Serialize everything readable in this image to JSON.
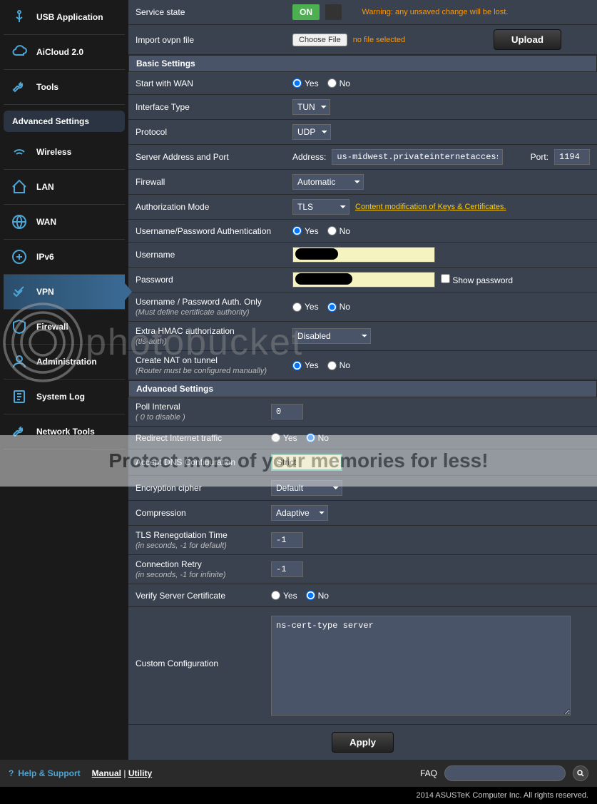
{
  "sidebar": {
    "topItems": [
      {
        "label": "USB Application",
        "icon": "usb"
      },
      {
        "label": "AiCloud 2.0",
        "icon": "cloud"
      },
      {
        "label": "Tools",
        "icon": "wrench"
      }
    ],
    "advancedHeader": "Advanced Settings",
    "advancedItems": [
      {
        "label": "Wireless",
        "icon": "wifi"
      },
      {
        "label": "LAN",
        "icon": "home"
      },
      {
        "label": "WAN",
        "icon": "globe"
      },
      {
        "label": "IPv6",
        "icon": "ipv6"
      },
      {
        "label": "VPN",
        "icon": "vpn",
        "active": true
      },
      {
        "label": "Firewall",
        "icon": "shield"
      },
      {
        "label": "Administration",
        "icon": "user"
      },
      {
        "label": "System Log",
        "icon": "log"
      },
      {
        "label": "Network Tools",
        "icon": "tools"
      }
    ]
  },
  "form": {
    "serviceStateLabel": "Service state",
    "serviceStateValue": "ON",
    "serviceStateWarning": "Warning: any unsaved change will be lost.",
    "importLabel": "Import ovpn file",
    "chooseFileLabel": "Choose File",
    "noFileSelected": "no file selected",
    "uploadLabel": "Upload",
    "basicSettingsHeader": "Basic Settings",
    "startWithWanLabel": "Start with WAN",
    "yes": "Yes",
    "no": "No",
    "interfaceTypeLabel": "Interface Type",
    "interfaceTypeValue": "TUN",
    "protocolLabel": "Protocol",
    "protocolValue": "UDP",
    "serverAddressLabel": "Server Address and Port",
    "addressPrefix": "Address:",
    "addressValue": "us-midwest.privateinternetaccess.",
    "portPrefix": "Port:",
    "portValue": "1194",
    "firewallLabel": "Firewall",
    "firewallValue": "Automatic",
    "authModeLabel": "Authorization Mode",
    "authModeValue": "TLS",
    "authModeLink": "Content modification of Keys & Certificates.",
    "userPassAuthLabel": "Username/Password Authentication",
    "usernameLabel": "Username",
    "usernameValue": "",
    "passwordLabel": "Password",
    "passwordValue": "",
    "showPasswordLabel": "Show password",
    "userPassOnlyLabel": "Username / Password Auth. Only",
    "userPassOnlySub": "(Must define certificate authority)",
    "extraHmacLabel": "Extra HMAC authorization",
    "extraHmacSub": "(tls-auth)",
    "extraHmacValue": "Disabled",
    "createNatLabel": "Create NAT on tunnel",
    "createNatSub": "(Router must be configured manually)",
    "advancedSettingsHeader": "Advanced Settings",
    "pollIntervalLabel": "Poll Interval",
    "pollIntervalSub": "( 0 to disable )",
    "pollIntervalValue": "0",
    "redirectLabel": "Redirect Internet traffic",
    "acceptDnsLabel": "Accept DNS Configuration",
    "acceptDnsValue": "Strict",
    "encryptionLabel": "Encryption cipher",
    "encryptionValue": "Default",
    "compressionLabel": "Compression",
    "compressionValue": "Adaptive",
    "tlsRenegLabel": "TLS Renegotiation Time",
    "tlsRenegSub": "(in seconds, -1 for default)",
    "tlsRenegValue": "-1",
    "connRetryLabel": "Connection Retry",
    "connRetrySub": "(in seconds, -1 for infinite)",
    "connRetryValue": "-1",
    "verifyServerLabel": "Verify Server Certificate",
    "customConfigLabel": "Custom Configuration",
    "customConfigValue": "ns-cert-type server",
    "applyLabel": "Apply"
  },
  "footer": {
    "helpSupport": "Help & Support",
    "manual": "Manual",
    "utility": "Utility",
    "faq": "FAQ",
    "copyright": "2014 ASUSTeK Computer Inc. All rights reserved."
  },
  "watermark": {
    "logo": "photobucket",
    "banner": "Protect more of your memories for less!"
  }
}
